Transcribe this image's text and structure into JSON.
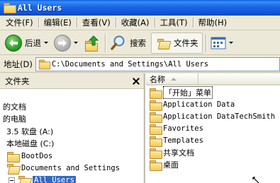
{
  "window": {
    "title": "All Users"
  },
  "menu": [
    {
      "label": "文件(F)"
    },
    {
      "label": "编辑(E)"
    },
    {
      "label": "查看(V)"
    },
    {
      "label": "收藏(A)"
    },
    {
      "label": "工具(T)"
    },
    {
      "label": "帮助(H)"
    }
  ],
  "toolbar": {
    "back_label": "后退",
    "search_label": "搜索",
    "folders_label": "文件夹"
  },
  "address": {
    "label": "地址(D)",
    "path": "C:\\Documents and Settings\\All Users"
  },
  "left_pane": {
    "title": "文件夹",
    "items": [
      {
        "label": "的文档"
      },
      {
        "label": "的电脑"
      },
      {
        "label": "3.5 软盘 (A:)"
      },
      {
        "label": "本地磁盘 (C:)"
      },
      {
        "label": "BootDos"
      },
      {
        "label": "Documents and Settings"
      },
      {
        "label": "All Users"
      }
    ]
  },
  "right_pane": {
    "column_name": "名称",
    "files": [
      {
        "label": "「开始」菜单"
      },
      {
        "label": "Application Data"
      },
      {
        "label": "Application DataTechSmith"
      },
      {
        "label": "Favorites"
      },
      {
        "label": "Templates"
      },
      {
        "label": "共享文档"
      },
      {
        "label": "桌面"
      }
    ]
  },
  "colors": {
    "titlebar": "#0A55D4",
    "selection": "#316AC5",
    "chrome": "#ECE9D8"
  }
}
